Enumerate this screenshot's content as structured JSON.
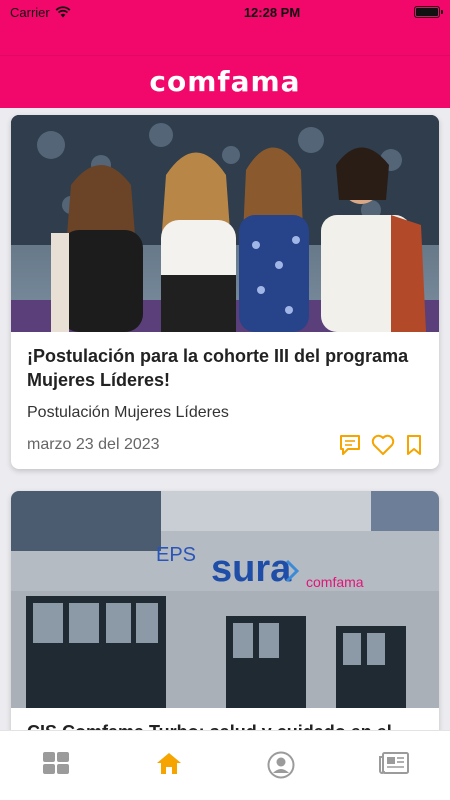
{
  "status_bar": {
    "carrier": "Carrier",
    "time": "12:28 PM"
  },
  "header": {
    "logo_text": "comfama",
    "brand_color": "#f2076a"
  },
  "feed": {
    "cards": [
      {
        "title": "¡Postulación para la cohorte III del programa Mujeres Líderes!",
        "subtitle": "Postulación Mujeres Líderes",
        "date": "marzo 23 del 2023"
      },
      {
        "title": "CIS Comfama Turbo: salud y cuidado en el",
        "photo_sign_eps": "EPS",
        "photo_sign_sura": "sura",
        "photo_sign_comfama": "comfama"
      }
    ]
  },
  "tab_bar": {
    "accent": "#f5a400",
    "items": [
      {
        "icon": "grid-icon",
        "active": false
      },
      {
        "icon": "home-icon",
        "active": true
      },
      {
        "icon": "profile-icon",
        "active": false
      },
      {
        "icon": "news-icon",
        "active": false
      }
    ]
  }
}
